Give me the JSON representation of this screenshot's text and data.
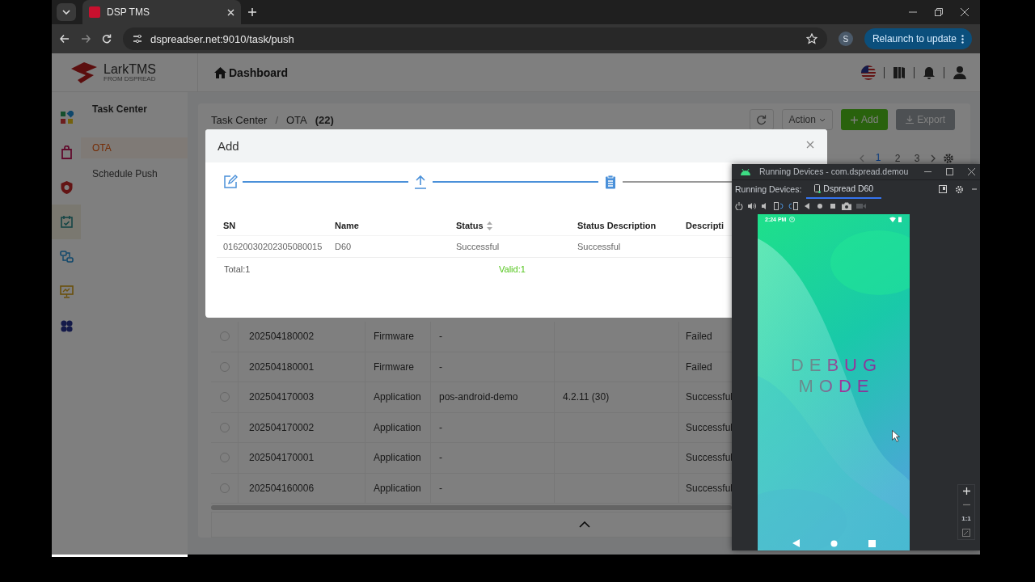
{
  "browser": {
    "tab_title": "DSP TMS",
    "url": "dspreadser.net:9010/task/push",
    "profile": "S",
    "update_button": "Relaunch to update"
  },
  "header": {
    "logo_name": "LarkTMS",
    "logo_tagline": "FROM DSPREAD",
    "page_title": "Dashboard"
  },
  "rail": [
    {
      "kind": "apps",
      "selected": false
    },
    {
      "kind": "bag",
      "selected": false
    },
    {
      "kind": "shield",
      "selected": false
    },
    {
      "kind": "calendar",
      "selected": true
    },
    {
      "kind": "flow",
      "selected": false
    },
    {
      "kind": "monitor",
      "selected": false
    },
    {
      "kind": "clover",
      "selected": false
    }
  ],
  "side_menu": {
    "title": "Task Center",
    "items": [
      {
        "label": "OTA",
        "selected": true
      },
      {
        "label": "Schedule Push",
        "selected": false
      }
    ]
  },
  "content": {
    "breadcrumb": [
      "Task Center",
      "OTA"
    ],
    "breadcrumb_separator": "/",
    "count": "(22)",
    "action_button": "Action",
    "add_button": "Add",
    "export_button": "Export",
    "pages": [
      {
        "label": "1",
        "selected": true
      },
      {
        "label": "2",
        "selected": false
      },
      {
        "label": "3",
        "selected": false
      }
    ]
  },
  "table": {
    "rows": [
      {
        "selected": false,
        "id": "202504180002",
        "type": "Firmware",
        "name": "-",
        "status": "Failed"
      },
      {
        "selected": false,
        "id": "202504180001",
        "type": "Firmware",
        "name": "-",
        "status": "Failed"
      },
      {
        "selected": false,
        "id": "202504170003",
        "type": "Application",
        "name": "pos-android-demo",
        "version": "4.2.11 (30)",
        "status": "Successful"
      },
      {
        "selected": false,
        "id": "202504170002",
        "type": "Application",
        "name": "-",
        "status": "Successful"
      },
      {
        "selected": false,
        "id": "202504170001",
        "type": "Application",
        "name": "-",
        "status": "Successful"
      },
      {
        "selected": false,
        "id": "202504160006",
        "type": "Application",
        "name": "-",
        "status": "Successful"
      }
    ]
  },
  "modal": {
    "title": "Add",
    "steps": [
      {
        "kind": "edit",
        "done": true,
        "active": false
      },
      {
        "kind": "upload",
        "done": true,
        "active": false
      },
      {
        "kind": "clipboard",
        "done": false,
        "active": true
      }
    ],
    "columns": [
      {
        "label": "SN",
        "sortable": false
      },
      {
        "label": "Name",
        "sortable": false
      },
      {
        "label": "Status",
        "sortable": true
      },
      {
        "label": "Status Description",
        "sortable": false
      },
      {
        "label": "Descripti",
        "sortable": false
      }
    ],
    "rows": [
      [
        "01620030202305080015",
        "D60",
        "Successful",
        "Successful"
      ]
    ],
    "total": "Total:1",
    "valid": "Valid:1"
  },
  "emulator": {
    "title": "Running Devices - com.dspread.demou",
    "label": "Running Devices:",
    "tab": "Dspread D60",
    "phone": {
      "time": "2:24 PM",
      "lines": [
        "DEBUG",
        "MODE"
      ]
    },
    "zoom_label": "1:1"
  }
}
